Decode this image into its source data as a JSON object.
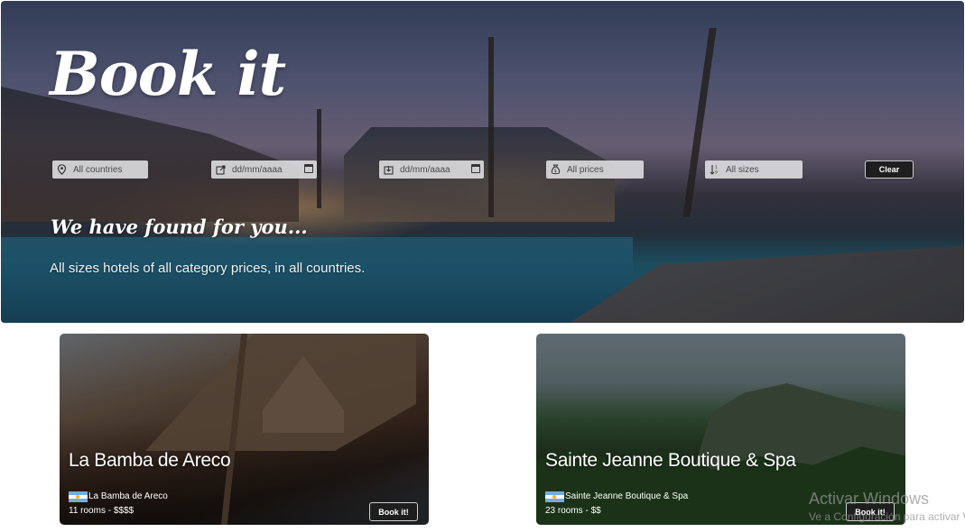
{
  "hero": {
    "brand": "Book it",
    "heading": "We have found for you...",
    "subheading": "All sizes hotels of all category prices, in all countries."
  },
  "filters": {
    "country": {
      "value": "All countries",
      "icon": "map-pin-icon"
    },
    "checkin": {
      "placeholder": "dd/mm/aaaa",
      "icon": "check-in-icon"
    },
    "checkout": {
      "placeholder": "dd/mm/aaaa",
      "icon": "check-out-icon"
    },
    "price": {
      "value": "All prices",
      "icon": "money-bag-icon"
    },
    "size": {
      "value": "All sizes",
      "icon": "sort-icon"
    },
    "clear_label": "Clear"
  },
  "hotels": [
    {
      "name": "La Bamba de Areco",
      "country_flag": "argentina-flag",
      "flag_text": "La Bamba de Areco",
      "summary": "11 rooms - $$$$",
      "book_label": "Book it!"
    },
    {
      "name": "Sainte Jeanne Boutique & Spa",
      "country_flag": "argentina-flag",
      "flag_text": "Sainte Jeanne Boutique & Spa",
      "summary": "23 rooms - $$",
      "book_label": "Book it!"
    }
  ],
  "watermark": {
    "title": "Activar Windows",
    "subtitle": "Ve a Configuración para activar Windows."
  },
  "colors": {
    "button_bg": "#1e1e1e",
    "filter_bg": "#e1e1e4",
    "flag_blue": "#74acdf"
  }
}
